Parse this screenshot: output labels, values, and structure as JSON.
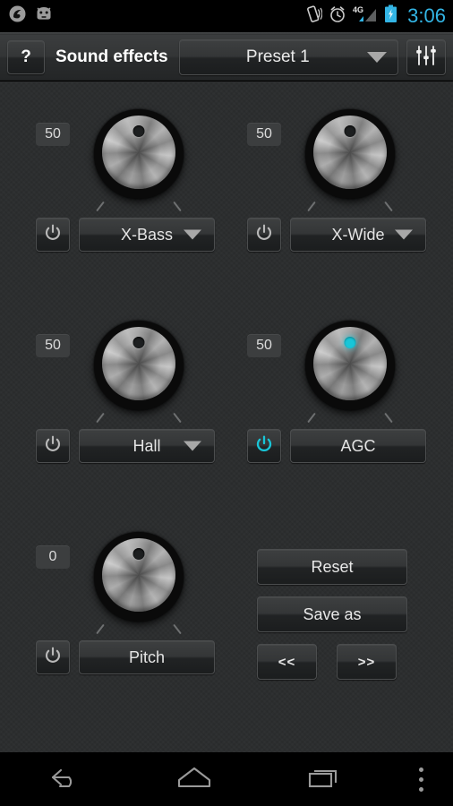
{
  "status_bar": {
    "notification_icons": [
      "app-logo-icon",
      "android-bugdroid-icon"
    ],
    "system_icons": [
      "vibrate-icon",
      "alarm-clock-icon",
      "signal-4g-icon",
      "battery-charging-icon"
    ],
    "network_label": "4G",
    "time": "3:06",
    "time_color": "#33b5e5"
  },
  "action_bar": {
    "help_label": "?",
    "title": "Sound effects",
    "preset_value": "Preset 1",
    "eq_icon": "equalizer-sliders-icon"
  },
  "theme": {
    "background": "#2b2d2e",
    "accent_on": "#18c6d8",
    "text": "#e8e8e8"
  },
  "effects": [
    {
      "id": "x-bass",
      "value": "50",
      "label": "X-Bass",
      "enabled": false,
      "has_dropdown": true
    },
    {
      "id": "x-wide",
      "value": "50",
      "label": "X-Wide",
      "enabled": false,
      "has_dropdown": true
    },
    {
      "id": "hall",
      "value": "50",
      "label": "Hall",
      "enabled": false,
      "has_dropdown": true
    },
    {
      "id": "agc",
      "value": "50",
      "label": "AGC",
      "enabled": true,
      "has_dropdown": false
    },
    {
      "id": "pitch",
      "value": "0",
      "label": "Pitch",
      "enabled": false,
      "has_dropdown": false
    }
  ],
  "actions": {
    "reset_label": "Reset",
    "save_as_label": "Save as",
    "prev_label": "<<",
    "next_label": ">>"
  },
  "nav_bar": {
    "back": "back-icon",
    "home": "home-icon",
    "recents": "recents-icon",
    "overflow": "overflow-menu-icon"
  }
}
